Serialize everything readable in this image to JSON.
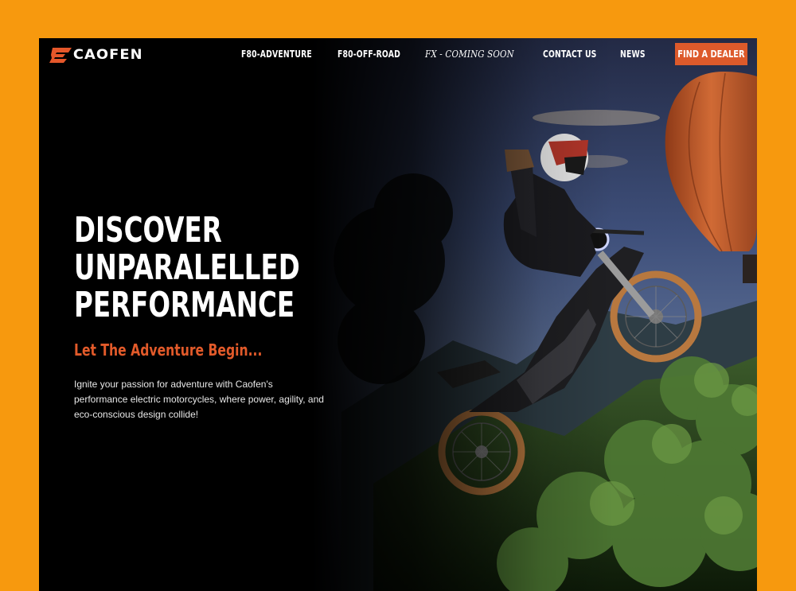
{
  "brand": {
    "name": "CAOFEN",
    "accent": "#dd5a2b",
    "page_bg": "#f7990e"
  },
  "nav": {
    "items": [
      {
        "label": "F80-ADVENTURE"
      },
      {
        "label": "F80-OFF-ROAD"
      },
      {
        "label": "FX - COMING SOON"
      },
      {
        "label": "CONTACT US"
      },
      {
        "label": "NEWS"
      }
    ],
    "cta_label": "FIND A DEALER"
  },
  "hero": {
    "headline": [
      "DISCOVER",
      "UNPARALELLED",
      "PERFORMANCE"
    ],
    "subhead": "Let The Adventure Begin...",
    "body": "Ignite your passion for adventure with Caofen's performance electric motorcycles, where power, agility, and eco-conscious design collide!"
  }
}
